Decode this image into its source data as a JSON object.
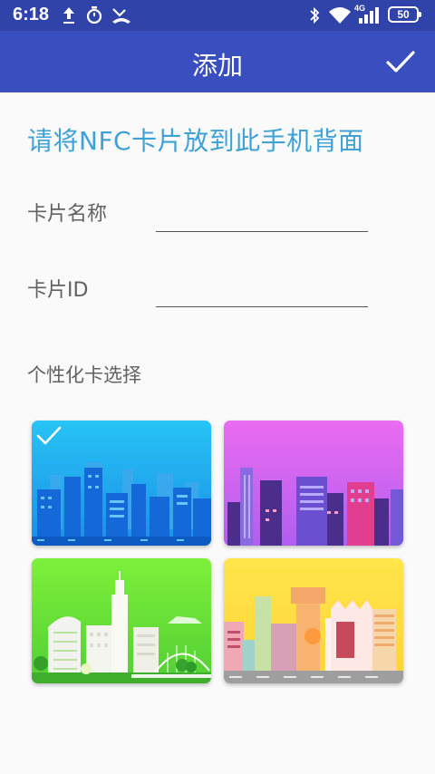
{
  "status_bar": {
    "time": "6:18",
    "network": "4G",
    "battery": "50"
  },
  "app_bar": {
    "title": "添加",
    "confirm_icon": "check-icon"
  },
  "instruction": "请将NFC卡片放到此手机背面",
  "form": {
    "card_name": {
      "label": "卡片名称",
      "value": ""
    },
    "card_id": {
      "label": "卡片ID",
      "value": ""
    }
  },
  "personalize": {
    "label": "个性化卡选择",
    "selected_index": 0,
    "cards": [
      {
        "theme": "blue-city"
      },
      {
        "theme": "purple-city"
      },
      {
        "theme": "green-city"
      },
      {
        "theme": "yellow-city"
      }
    ]
  },
  "colors": {
    "status_bar": "#2f43a8",
    "app_bar": "#3a4fbf",
    "accent_text": "#3ea2d6"
  }
}
